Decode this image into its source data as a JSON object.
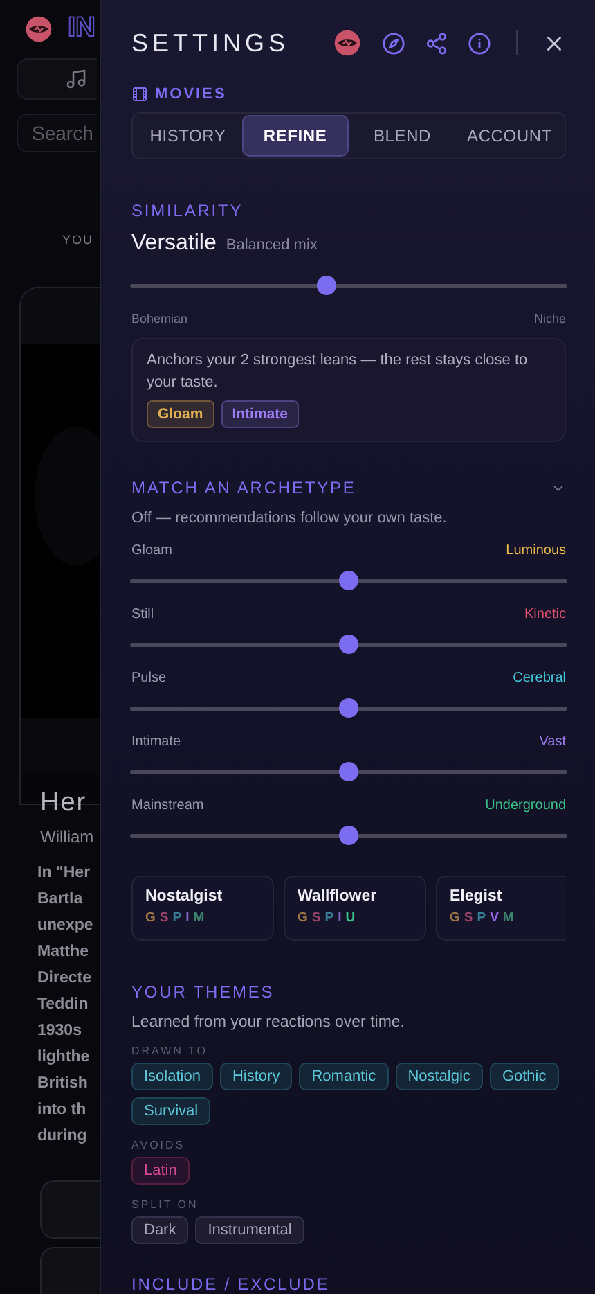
{
  "backdrop": {
    "brand": "IN",
    "search": {
      "placeholder": "Search"
    },
    "section_label": "YOU",
    "title": "Her",
    "subtitle": "William",
    "description_lines": [
      "In \"Her",
      "Bartla",
      "unexpe",
      "Matthe",
      "Directe",
      "Teddin",
      "1930s",
      "lighthe",
      "British",
      "into th",
      "during"
    ]
  },
  "settings": {
    "title": "SETTINGS",
    "category": "MOVIES",
    "tabs": [
      {
        "label": "HISTORY",
        "selected": false
      },
      {
        "label": "REFINE",
        "selected": true
      },
      {
        "label": "BLEND",
        "selected": false
      },
      {
        "label": "ACCOUNT",
        "selected": false
      }
    ],
    "similarity": {
      "heading": "SIMILARITY",
      "value": "Versatile",
      "value_note": "Balanced mix",
      "level": 0.45,
      "left_label": "Bohemian",
      "right_label": "Niche",
      "note": "Anchors your 2 strongest leans — the rest stays close to your taste.",
      "chips": [
        {
          "label": "Gloam",
          "color": "#e0b04e"
        },
        {
          "label": "Intimate",
          "color": "#9a7cf0"
        }
      ]
    },
    "archetype": {
      "heading": "MATCH AN ARCHETYPE",
      "status": "Off — recommendations follow your own taste.",
      "sliders": [
        {
          "left": "Gloam",
          "right": "Luminous",
          "color": "#e8b84a",
          "level": 0.5
        },
        {
          "left": "Still",
          "right": "Kinetic",
          "color": "#e0506e",
          "level": 0.5
        },
        {
          "left": "Pulse",
          "right": "Cerebral",
          "color": "#40c8d8",
          "level": 0.5
        },
        {
          "left": "Intimate",
          "right": "Vast",
          "color": "#9a7cf0",
          "level": 0.5
        },
        {
          "left": "Mainstream",
          "right": "Underground",
          "color": "#3cc08a",
          "level": 0.5
        }
      ],
      "cards": [
        {
          "name": "Nostalgist",
          "letters": [
            {
              "letter": "G",
              "color": "#9a7448"
            },
            {
              "letter": "S",
              "color": "#9a4468"
            },
            {
              "letter": "P",
              "color": "#3a7e98"
            },
            {
              "letter": "I",
              "color": "#7a62c0"
            },
            {
              "letter": "M",
              "color": "#3a826c"
            }
          ]
        },
        {
          "name": "Wallflower",
          "letters": [
            {
              "letter": "G",
              "color": "#9a7448"
            },
            {
              "letter": "S",
              "color": "#9a4468"
            },
            {
              "letter": "P",
              "color": "#3a7e98"
            },
            {
              "letter": "I",
              "color": "#7a62c0"
            },
            {
              "letter": "U",
              "color": "#3cc08a"
            }
          ]
        },
        {
          "name": "Elegist",
          "letters": [
            {
              "letter": "G",
              "color": "#9a7448"
            },
            {
              "letter": "S",
              "color": "#9a4468"
            },
            {
              "letter": "P",
              "color": "#3a7e98"
            },
            {
              "letter": "V",
              "color": "#9a6af0"
            },
            {
              "letter": "M",
              "color": "#3a826c"
            }
          ]
        }
      ]
    },
    "themes": {
      "heading": "YOUR THEMES",
      "description": "Learned from your reactions over time.",
      "groups": [
        {
          "label": "DRAWN TO",
          "kind": "drawn",
          "chips": [
            "Isolation",
            "History",
            "Romantic",
            "Nostalgic",
            "Gothic",
            "Survival"
          ]
        },
        {
          "label": "AVOIDS",
          "kind": "avoid",
          "chips": [
            "Latin"
          ]
        },
        {
          "label": "SPLIT ON",
          "kind": "split",
          "chips": [
            "Dark",
            "Instrumental"
          ]
        }
      ]
    },
    "next_heading": "INCLUDE / EXCLUDE"
  }
}
